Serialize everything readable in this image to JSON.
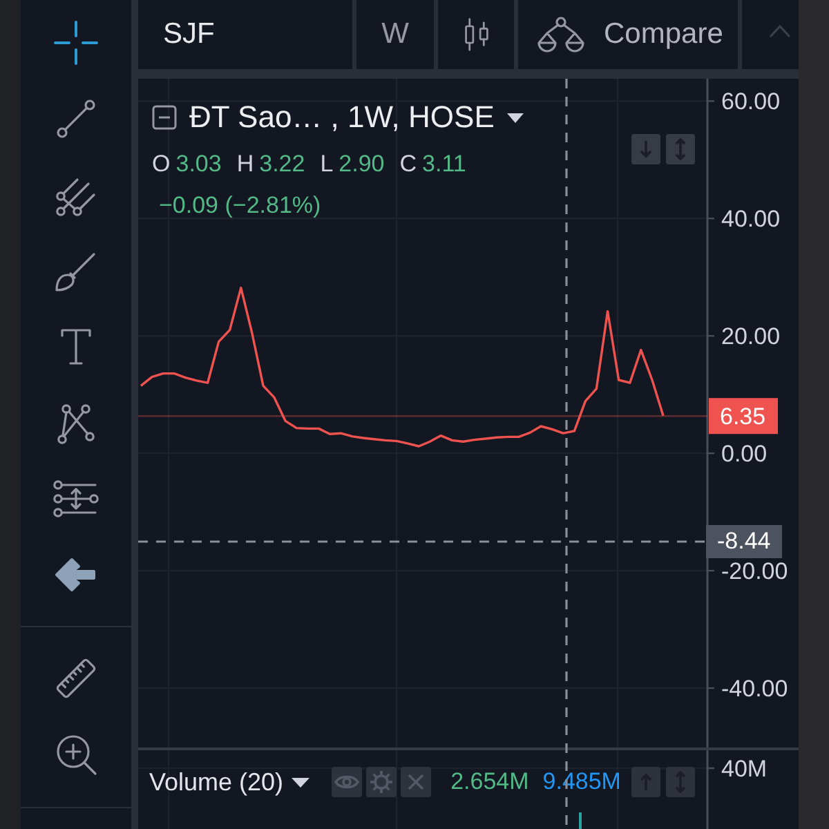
{
  "toolbar": {
    "groups": [
      {
        "tools": [
          {
            "selected": true
          },
          {
            "selected": false
          },
          {
            "selected": false
          },
          {
            "selected": false
          },
          {
            "selected": false
          },
          {
            "selected": false
          },
          {
            "selected": false
          },
          {
            "selected": false
          }
        ]
      },
      {
        "tools": [
          {
            "selected": false
          },
          {
            "selected": false
          }
        ]
      }
    ]
  },
  "top_bar": {
    "symbol": "SJF",
    "interval": "W",
    "compare": "Compare"
  },
  "chart": {
    "legend": {
      "title": "ĐT Sao… , 1W, HOSE",
      "ohlc": [
        {
          "label": "O",
          "value": "3.03"
        },
        {
          "label": "H",
          "value": "3.22"
        },
        {
          "label": "L",
          "value": "2.90"
        },
        {
          "label": "C",
          "value": "3.11"
        }
      ],
      "change": "−0.09 (−2.81%)"
    },
    "chart_data": {
      "type": "line",
      "grid": true,
      "ylim": [
        -64,
        63.8
      ],
      "yticks": [
        {
          "value": 60,
          "label": "60.00"
        },
        {
          "value": 40,
          "label": "40.00"
        },
        {
          "value": 20,
          "label": "20.00"
        },
        {
          "value": 0,
          "label": "0.00"
        },
        {
          "value": -20,
          "label": "-20.00"
        },
        {
          "value": -40,
          "label": "-40.00"
        }
      ],
      "series": [
        {
          "color": "#ef5350",
          "values": [
            11.5,
            13,
            13.6,
            13.6,
            12.9,
            12.4,
            12,
            19,
            21,
            28.2,
            20.5,
            11.5,
            9.5,
            5.5,
            4.3,
            4.2,
            4.2,
            3.3,
            3.4,
            2.9,
            2.6,
            2.4,
            2.2,
            2.1,
            1.7,
            1.2,
            2,
            3,
            2.2,
            2,
            2.3,
            2.5,
            2.7,
            2.8,
            2.8,
            3.5,
            4.6,
            4.1,
            3.4,
            3.8,
            8.9,
            11,
            24.2,
            12.5,
            12,
            17.6,
            12.5,
            6.4
          ]
        }
      ],
      "ref_lines": [
        {
          "axis": "y",
          "value": 6.35,
          "label": "6.35",
          "color": "#ef5350"
        }
      ]
    },
    "crosshair_price": "-8.44"
  },
  "volume": {
    "title": "Volume (20)",
    "readings": [
      {
        "text": "2.654M",
        "color": "#53b987"
      },
      {
        "text": "9.485M",
        "color": "#2196f3"
      }
    ],
    "axis_label": "40M"
  }
}
